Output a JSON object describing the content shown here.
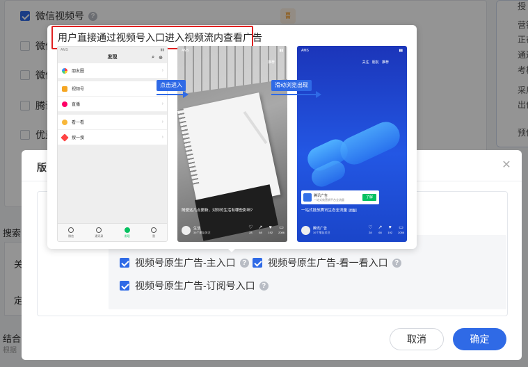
{
  "background": {
    "options": [
      {
        "label": "微信视频号",
        "checked": true
      },
      {
        "label": "微信",
        "checked": false
      },
      {
        "label": "微信",
        "checked": false
      },
      {
        "label": "腾讯",
        "checked": false
      },
      {
        "label": "优量",
        "checked": false
      }
    ],
    "brand_glyph": "ʬ",
    "left_labels": {
      "search": "搜索",
      "close": "关",
      "fixed": "定",
      "combine": "结合",
      "combine_hint": "根据"
    },
    "sidebar_labels": [
      "授",
      "营销",
      "正在",
      "通过",
      "考核",
      "采用",
      "出价",
      "预估"
    ]
  },
  "modal": {
    "title": "版",
    "close_glyph": "✕",
    "options": [
      {
        "label": "视频号原生广告-主入口",
        "checked": true
      },
      {
        "label": "视频号原生广告-看一看入口",
        "checked": true
      },
      {
        "label": "视频号原生广告-订阅号入口",
        "checked": true
      }
    ],
    "cancel_label": "取消",
    "ok_label": "确定"
  },
  "tooltip": {
    "title": "用户直接通过视频号入口进入视频流内查看广告",
    "arrow1_label": "点击进入",
    "arrow2_label": "滑动浏览出现",
    "phone1": {
      "status_left": "AMS",
      "header": "发现",
      "items": [
        "朋友圈",
        "视频号",
        "直播",
        "看一看",
        "搜一搜"
      ],
      "tabbar": [
        "微信",
        "通讯录",
        "发现",
        "我"
      ]
    },
    "phone2": {
      "tab_active": "推荐",
      "caption": "随便这几点更新，对你的生活有哪些影响?",
      "name": "生活",
      "name_sub": "36个朋友关注",
      "counts": [
        "28",
        "68",
        "192",
        "2086"
      ]
    },
    "phone3": {
      "tabs": [
        "关注",
        "朋友",
        "推荐"
      ],
      "ad_name": "腾讯广告",
      "ad_sub": "一站式效营销平台全流量",
      "ad_button": "了解",
      "caption": "一站式投放腾讯生态全流量",
      "caption_tag": "广告",
      "name": "腾讯广告",
      "name_sub": "36个朋友关注",
      "counts": [
        "28",
        "68",
        "192",
        "2086"
      ]
    }
  },
  "colors": {
    "accent": "#2f6ae6",
    "highlight_border": "#e02020",
    "wechat_green": "#07c160"
  }
}
